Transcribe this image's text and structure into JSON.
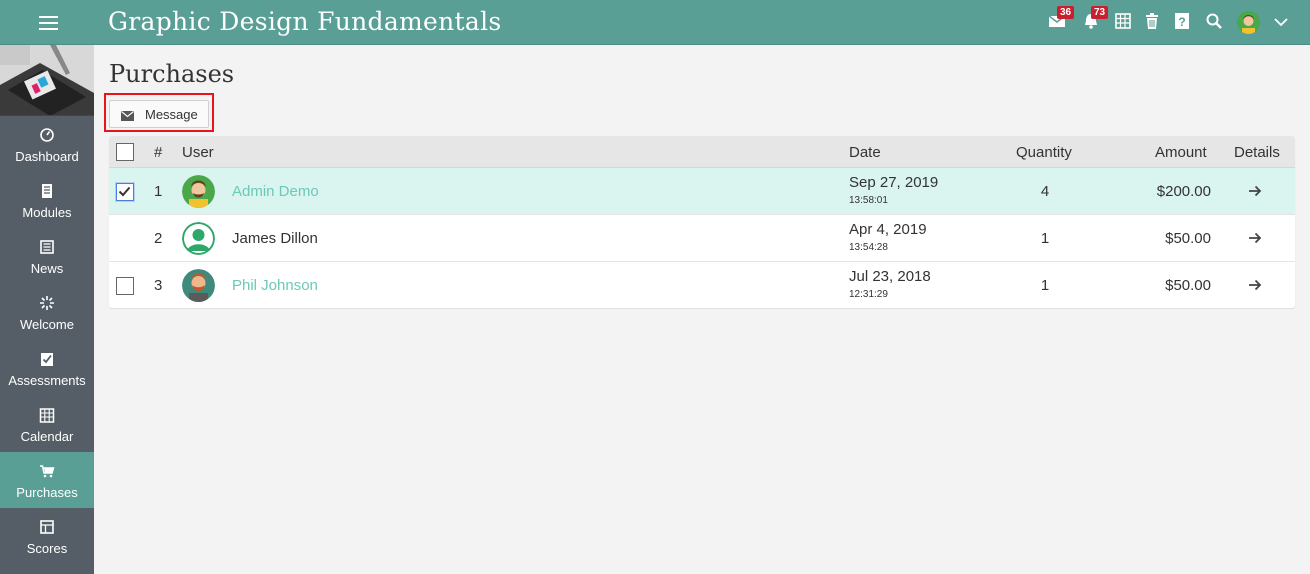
{
  "header": {
    "title": "Graphic Design Fundamentals",
    "mail_badge": "36",
    "notifications_badge": "73"
  },
  "sidebar": {
    "items": [
      {
        "label": "Dashboard",
        "icon": "dashboard-icon"
      },
      {
        "label": "Modules",
        "icon": "modules-icon"
      },
      {
        "label": "News",
        "icon": "news-icon"
      },
      {
        "label": "Welcome",
        "icon": "welcome-icon"
      },
      {
        "label": "Assessments",
        "icon": "assessments-icon"
      },
      {
        "label": "Calendar",
        "icon": "calendar-icon"
      },
      {
        "label": "Purchases",
        "icon": "cart-icon",
        "active": true
      },
      {
        "label": "Scores",
        "icon": "scores-icon"
      }
    ]
  },
  "main": {
    "page_title": "Purchases",
    "message_button": "Message",
    "columns": {
      "index": "#",
      "user": "User",
      "date": "Date",
      "quantity": "Quantity",
      "amount": "Amount",
      "details": "Details"
    },
    "rows": [
      {
        "index": "1",
        "user": "Admin Demo",
        "date": "Sep 27, 2019",
        "time": "13:58:01",
        "quantity": "4",
        "amount": "$200.00",
        "checked": true,
        "link": true
      },
      {
        "index": "2",
        "user": "James Dillon",
        "date": "Apr 4, 2019",
        "time": "13:54:28",
        "quantity": "1",
        "amount": "$50.00",
        "checked": false,
        "link": false
      },
      {
        "index": "3",
        "user": "Phil Johnson",
        "date": "Jul 23, 2018",
        "time": "12:31:29",
        "quantity": "1",
        "amount": "$50.00",
        "checked": false,
        "link": true
      }
    ]
  },
  "colors": {
    "brand": "#5a9f96",
    "sidebar": "#555e66",
    "link": "#6bc9b8",
    "selected_row": "#daf4ef",
    "badge": "#c8202f"
  }
}
